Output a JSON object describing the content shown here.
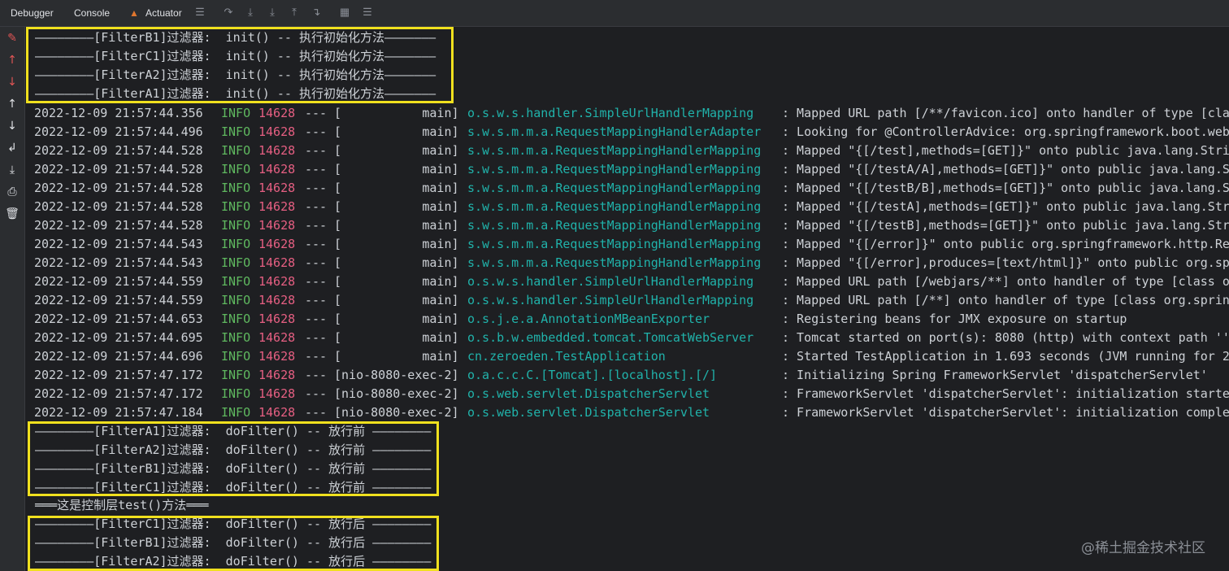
{
  "toolbar": {
    "tabs": [
      "Debugger",
      "Console",
      "Actuator"
    ],
    "active_tab": "Console",
    "icons": [
      "menu-icon",
      "restore-icon",
      "step-over-icon",
      "step-into-icon",
      "step-out-icon",
      "run-to-cursor-icon",
      "evaluate-icon",
      "settings-icon"
    ]
  },
  "gutter": {
    "icons": [
      "clear-icon",
      "up-red-icon",
      "down-red-icon",
      "up-icon",
      "down-icon",
      "soft-wrap-icon",
      "scroll-end-icon",
      "print-icon",
      "trash-icon"
    ]
  },
  "filter_lines_top": [
    "————————[FilterB1]过滤器:  init() -- 执行初始化方法———————",
    "————————[FilterC1]过滤器:  init() -- 执行初始化方法———————",
    "————————[FilterA2]过滤器:  init() -- 执行初始化方法———————",
    "————————[FilterA1]过滤器:  init() -- 执行初始化方法———————"
  ],
  "log_rows": [
    {
      "ts": "2022-12-09 21:57:44.356",
      "level": "INFO",
      "pid": "14628",
      "sep": "---",
      "thread": "[           main]",
      "logger": "o.s.w.s.handler.SimpleUrlHandlerMapping",
      "msg": ": Mapped URL path [/**/favicon.ico] onto handler of type [cla"
    },
    {
      "ts": "2022-12-09 21:57:44.496",
      "level": "INFO",
      "pid": "14628",
      "sep": "---",
      "thread": "[           main]",
      "logger": "s.w.s.m.m.a.RequestMappingHandlerAdapter",
      "msg": ": Looking for @ControllerAdvice: org.springframework.boot.web"
    },
    {
      "ts": "2022-12-09 21:57:44.528",
      "level": "INFO",
      "pid": "14628",
      "sep": "---",
      "thread": "[           main]",
      "logger": "s.w.s.m.m.a.RequestMappingHandlerMapping",
      "msg": ": Mapped \"{[/test],methods=[GET]}\" onto public java.lang.Stri"
    },
    {
      "ts": "2022-12-09 21:57:44.528",
      "level": "INFO",
      "pid": "14628",
      "sep": "---",
      "thread": "[           main]",
      "logger": "s.w.s.m.m.a.RequestMappingHandlerMapping",
      "msg": ": Mapped \"{[/testA/A],methods=[GET]}\" onto public java.lang.S"
    },
    {
      "ts": "2022-12-09 21:57:44.528",
      "level": "INFO",
      "pid": "14628",
      "sep": "---",
      "thread": "[           main]",
      "logger": "s.w.s.m.m.a.RequestMappingHandlerMapping",
      "msg": ": Mapped \"{[/testB/B],methods=[GET]}\" onto public java.lang.S"
    },
    {
      "ts": "2022-12-09 21:57:44.528",
      "level": "INFO",
      "pid": "14628",
      "sep": "---",
      "thread": "[           main]",
      "logger": "s.w.s.m.m.a.RequestMappingHandlerMapping",
      "msg": ": Mapped \"{[/testA],methods=[GET]}\" onto public java.lang.Str"
    },
    {
      "ts": "2022-12-09 21:57:44.528",
      "level": "INFO",
      "pid": "14628",
      "sep": "---",
      "thread": "[           main]",
      "logger": "s.w.s.m.m.a.RequestMappingHandlerMapping",
      "msg": ": Mapped \"{[/testB],methods=[GET]}\" onto public java.lang.Str"
    },
    {
      "ts": "2022-12-09 21:57:44.543",
      "level": "INFO",
      "pid": "14628",
      "sep": "---",
      "thread": "[           main]",
      "logger": "s.w.s.m.m.a.RequestMappingHandlerMapping",
      "msg": ": Mapped \"{[/error]}\" onto public org.springframework.http.Re"
    },
    {
      "ts": "2022-12-09 21:57:44.543",
      "level": "INFO",
      "pid": "14628",
      "sep": "---",
      "thread": "[           main]",
      "logger": "s.w.s.m.m.a.RequestMappingHandlerMapping",
      "msg": ": Mapped \"{[/error],produces=[text/html]}\" onto public org.sp"
    },
    {
      "ts": "2022-12-09 21:57:44.559",
      "level": "INFO",
      "pid": "14628",
      "sep": "---",
      "thread": "[           main]",
      "logger": "o.s.w.s.handler.SimpleUrlHandlerMapping",
      "msg": ": Mapped URL path [/webjars/**] onto handler of type [class o"
    },
    {
      "ts": "2022-12-09 21:57:44.559",
      "level": "INFO",
      "pid": "14628",
      "sep": "---",
      "thread": "[           main]",
      "logger": "o.s.w.s.handler.SimpleUrlHandlerMapping",
      "msg": ": Mapped URL path [/**] onto handler of type [class org.sprin"
    },
    {
      "ts": "2022-12-09 21:57:44.653",
      "level": "INFO",
      "pid": "14628",
      "sep": "---",
      "thread": "[           main]",
      "logger": "o.s.j.e.a.AnnotationMBeanExporter",
      "msg": ": Registering beans for JMX exposure on startup"
    },
    {
      "ts": "2022-12-09 21:57:44.695",
      "level": "INFO",
      "pid": "14628",
      "sep": "---",
      "thread": "[           main]",
      "logger": "o.s.b.w.embedded.tomcat.TomcatWebServer",
      "msg": ": Tomcat started on port(s): 8080 (http) with context path ''"
    },
    {
      "ts": "2022-12-09 21:57:44.696",
      "level": "INFO",
      "pid": "14628",
      "sep": "---",
      "thread": "[           main]",
      "logger": "cn.zeroeden.TestApplication",
      "msg": ": Started TestApplication in 1.693 seconds (JVM running for 2"
    },
    {
      "ts": "2022-12-09 21:57:47.172",
      "level": "INFO",
      "pid": "14628",
      "sep": "---",
      "thread": "[nio-8080-exec-2]",
      "logger": "o.a.c.c.C.[Tomcat].[localhost].[/]",
      "msg": ": Initializing Spring FrameworkServlet 'dispatcherServlet'"
    },
    {
      "ts": "2022-12-09 21:57:47.172",
      "level": "INFO",
      "pid": "14628",
      "sep": "---",
      "thread": "[nio-8080-exec-2]",
      "logger": "o.s.web.servlet.DispatcherServlet",
      "msg": ": FrameworkServlet 'dispatcherServlet': initialization starte"
    },
    {
      "ts": "2022-12-09 21:57:47.184",
      "level": "INFO",
      "pid": "14628",
      "sep": "---",
      "thread": "[nio-8080-exec-2]",
      "logger": "o.s.web.servlet.DispatcherServlet",
      "msg": ": FrameworkServlet 'dispatcherServlet': initialization comple"
    }
  ],
  "filter_lines_before": [
    "————————[FilterA1]过滤器:  doFilter() -- 放行前 ————————",
    "————————[FilterA2]过滤器:  doFilter() -- 放行前 ————————",
    "————————[FilterB1]过滤器:  doFilter() -- 放行前 ————————",
    "————————[FilterC1]过滤器:  doFilter() -- 放行前 ————————"
  ],
  "controller_line": "═══这是控制层test()方法═══",
  "filter_lines_after": [
    "————————[FilterC1]过滤器:  doFilter() -- 放行后 ————————",
    "————————[FilterB1]过滤器:  doFilter() -- 放行后 ————————",
    "————————[FilterA2]过滤器:  doFilter() -- 放行后 ————————"
  ],
  "watermark": "@稀土掘金技术社区",
  "colors": {
    "background": "#1e1f22",
    "level": "#5fb85f",
    "pid": "#e65f82",
    "logger": "#20b2aa",
    "highlight": "#f0e01e"
  }
}
